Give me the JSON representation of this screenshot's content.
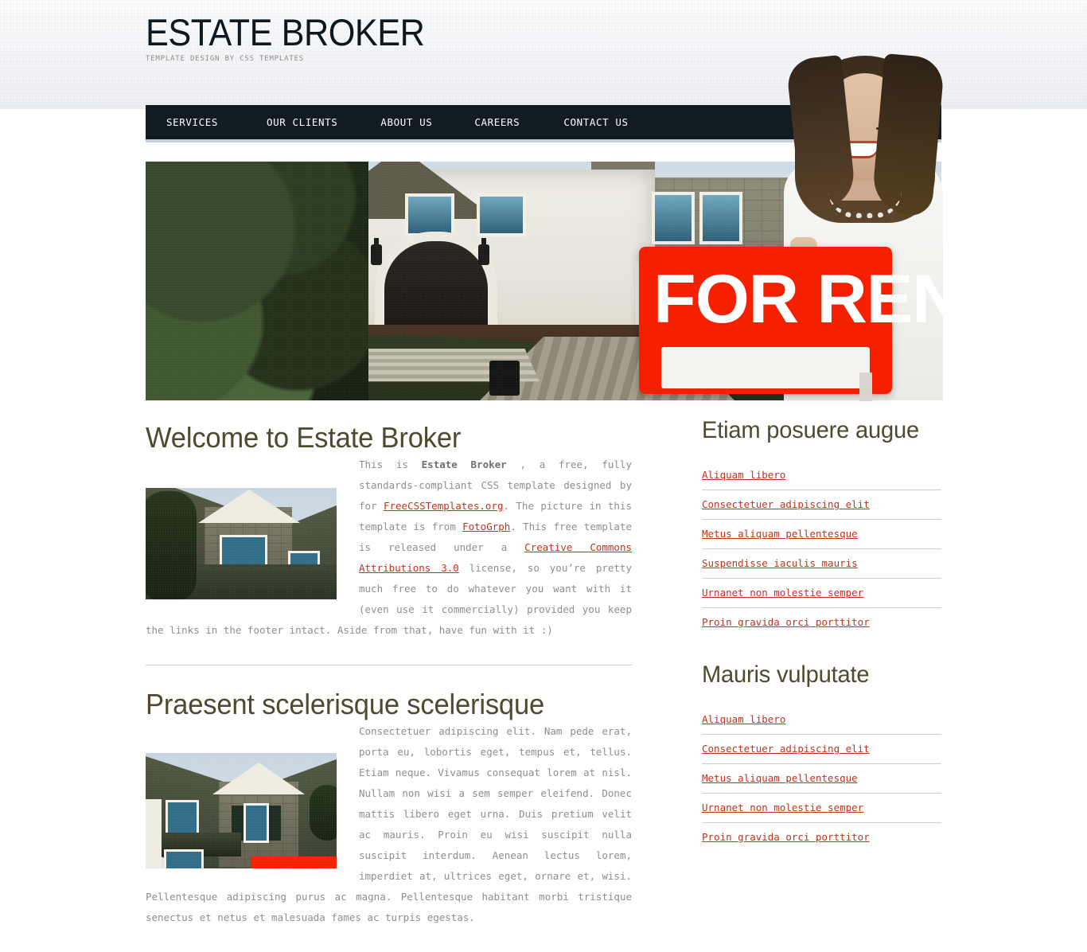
{
  "site": {
    "title": "ESTATE BROKER",
    "tagline": "Template design by CSS Templates"
  },
  "nav": {
    "items": [
      {
        "label": "Services"
      },
      {
        "label": "Our Clients"
      },
      {
        "label": "About Us"
      },
      {
        "label": "Careers"
      },
      {
        "label": "Contact Us"
      }
    ]
  },
  "banner": {
    "sign_text": "FOR RENT",
    "alt": "real-estate-agent-holding-for-rent-sign"
  },
  "content": {
    "articles": [
      {
        "heading": "Welcome to Estate Broker",
        "image_alt": "stone-house-thumbnail",
        "paragraph_parts": [
          {
            "type": "text",
            "text": "This is "
          },
          {
            "type": "bold",
            "text": "Estate Broker"
          },
          {
            "type": "text",
            "text": " , a free, fully standards-compliant CSS template designed by for "
          },
          {
            "type": "link",
            "text": "FreeCSSTemplates.org"
          },
          {
            "type": "text",
            "text": ". The picture in this template is from "
          },
          {
            "type": "link",
            "text": "FotoGrph"
          },
          {
            "type": "text",
            "text": ". This free template is released under a "
          },
          {
            "type": "link",
            "text": "Creative Commons Attributions 3.0"
          },
          {
            "type": "text",
            "text": " license, so you’re pretty much free to do whatever you want with it (even use it commercially) provided you keep the links in the footer intact. Aside from that, have fun with it :)"
          }
        ]
      },
      {
        "heading": "Praesent scelerisque scelerisque",
        "image_alt": "stone-house-with-red-sign-thumbnail",
        "paragraph": "Consectetuer adipiscing elit. Nam pede erat, porta eu, lobortis eget, tempus et, tellus. Etiam neque. Vivamus consequat lorem at nisl. Nullam non wisi a sem semper eleifend. Donec mattis libero eget urna. Duis pretium velit ac mauris. Proin eu wisi suscipit nulla suscipit interdum. Aenean lectus lorem, imperdiet at, ultrices eget, ornare et, wisi. Pellentesque adipiscing purus ac magna. Pellentesque habitant morbi tristique senectus et netus et malesuada fames ac turpis egestas."
      }
    ]
  },
  "sidebar": {
    "blocks": [
      {
        "heading": "Etiam posuere augue",
        "links": [
          "Aliquam libero",
          "Consectetuer adipiscing elit",
          "Metus aliquam pellentesque",
          "Suspendisse iaculis mauris",
          "Urnanet non molestie semper",
          "Proin gravida orci porttitor"
        ]
      },
      {
        "heading": "Mauris vulputate",
        "links": [
          "Aliquam libero",
          "Consectetuer adipiscing elit",
          "Metus aliquam pellentesque",
          "Urnanet non molestie semper",
          "Proin gravida orci porttitor"
        ]
      }
    ]
  },
  "colors": {
    "nav_bg": "#101b22",
    "nav_border": "#c3ced9",
    "heading": "#4d4a2e",
    "link": "#c5321b",
    "body_text": "#8e8e8e",
    "rule": "#c8cfd9",
    "sign_red": "#f42000"
  }
}
